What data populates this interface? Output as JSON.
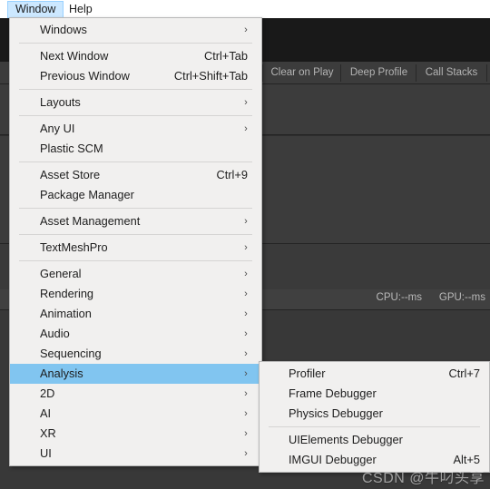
{
  "menubar": {
    "items": [
      {
        "label": "Window",
        "active": true
      },
      {
        "label": "Help",
        "active": false
      }
    ]
  },
  "background": {
    "app": "Unity Editor - Profiler",
    "toolbar_buttons": [
      {
        "label": "Clear on Play"
      },
      {
        "label": "Deep Profile"
      },
      {
        "label": "Call Stacks"
      }
    ],
    "performance": {
      "cpu": "CPU:--ms",
      "gpu": "GPU:--ms"
    },
    "colors": {
      "panel": "#3c3c3c",
      "toolbar": "#191919",
      "row": "#404040",
      "line": "#232323",
      "text": "#b4b4b4"
    }
  },
  "main_menu": {
    "name": "Window",
    "highlight_color": "#81c5f0",
    "items": [
      {
        "label": "Windows",
        "shortcut": "",
        "submenu": true
      },
      {
        "separator": true
      },
      {
        "label": "Next Window",
        "shortcut": "Ctrl+Tab",
        "submenu": false
      },
      {
        "label": "Previous Window",
        "shortcut": "Ctrl+Shift+Tab",
        "submenu": false
      },
      {
        "separator": true
      },
      {
        "label": "Layouts",
        "shortcut": "",
        "submenu": true
      },
      {
        "separator": true
      },
      {
        "label": "Any UI",
        "shortcut": "",
        "submenu": true
      },
      {
        "label": "Plastic SCM",
        "shortcut": "",
        "submenu": false
      },
      {
        "separator": true
      },
      {
        "label": "Asset Store",
        "shortcut": "Ctrl+9",
        "submenu": false
      },
      {
        "label": "Package Manager",
        "shortcut": "",
        "submenu": false
      },
      {
        "separator": true
      },
      {
        "label": "Asset Management",
        "shortcut": "",
        "submenu": true
      },
      {
        "separator": true
      },
      {
        "label": "TextMeshPro",
        "shortcut": "",
        "submenu": true
      },
      {
        "separator": true
      },
      {
        "label": "General",
        "shortcut": "",
        "submenu": true
      },
      {
        "label": "Rendering",
        "shortcut": "",
        "submenu": true
      },
      {
        "label": "Animation",
        "shortcut": "",
        "submenu": true
      },
      {
        "label": "Audio",
        "shortcut": "",
        "submenu": true
      },
      {
        "label": "Sequencing",
        "shortcut": "",
        "submenu": true
      },
      {
        "label": "Analysis",
        "shortcut": "",
        "submenu": true,
        "highlighted": true
      },
      {
        "label": "2D",
        "shortcut": "",
        "submenu": true
      },
      {
        "label": "AI",
        "shortcut": "",
        "submenu": true
      },
      {
        "label": "XR",
        "shortcut": "",
        "submenu": true
      },
      {
        "label": "UI",
        "shortcut": "",
        "submenu": true
      }
    ]
  },
  "sub_menu": {
    "name": "Analysis",
    "items": [
      {
        "label": "Profiler",
        "shortcut": "Ctrl+7",
        "submenu": false
      },
      {
        "label": "Frame Debugger",
        "shortcut": "",
        "submenu": false
      },
      {
        "label": "Physics Debugger",
        "shortcut": "",
        "submenu": false
      },
      {
        "separator": true
      },
      {
        "label": "UIElements Debugger",
        "shortcut": "",
        "submenu": false
      },
      {
        "label": "IMGUI Debugger",
        "shortcut": "Alt+5",
        "submenu": false
      }
    ]
  },
  "watermark": {
    "text": "CSDN @牛叼头享"
  },
  "icons": {
    "submenu_arrow": "›"
  }
}
